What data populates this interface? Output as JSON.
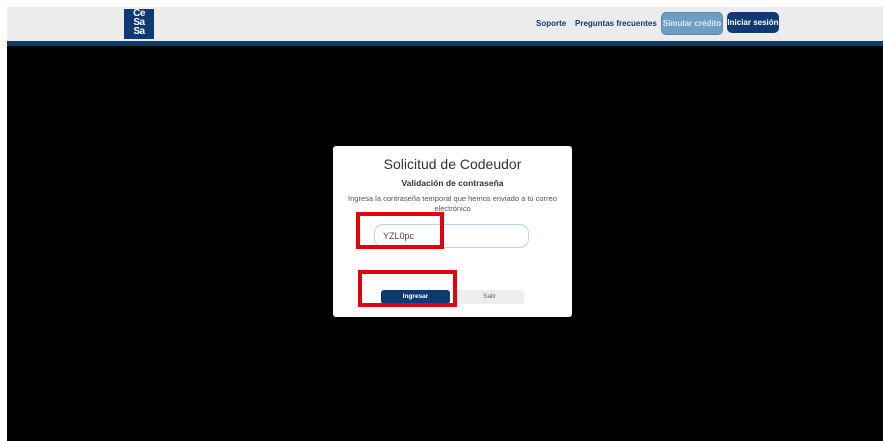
{
  "navbar": {
    "logo_lines": [
      "Ce",
      "Sa"
    ],
    "links": {
      "soporte": "Soporte",
      "faq": "Preguntas frecuentes"
    },
    "buttons": {
      "simular": "Simular crédito",
      "login": "Iniciar sesión"
    },
    "brand_color": "#0e3a73"
  },
  "modal": {
    "title": "Solicitud de Codeudor",
    "subtitle": "Validación de contraseña",
    "description": "Ingresa la contraseña temporal que hemos enviado a tu correo electrónico",
    "password_value": "YZL0pc",
    "primary_button": "Ingresar",
    "secondary_button": "Salir"
  },
  "annotations": {
    "highlight_color": "#e3000f"
  }
}
